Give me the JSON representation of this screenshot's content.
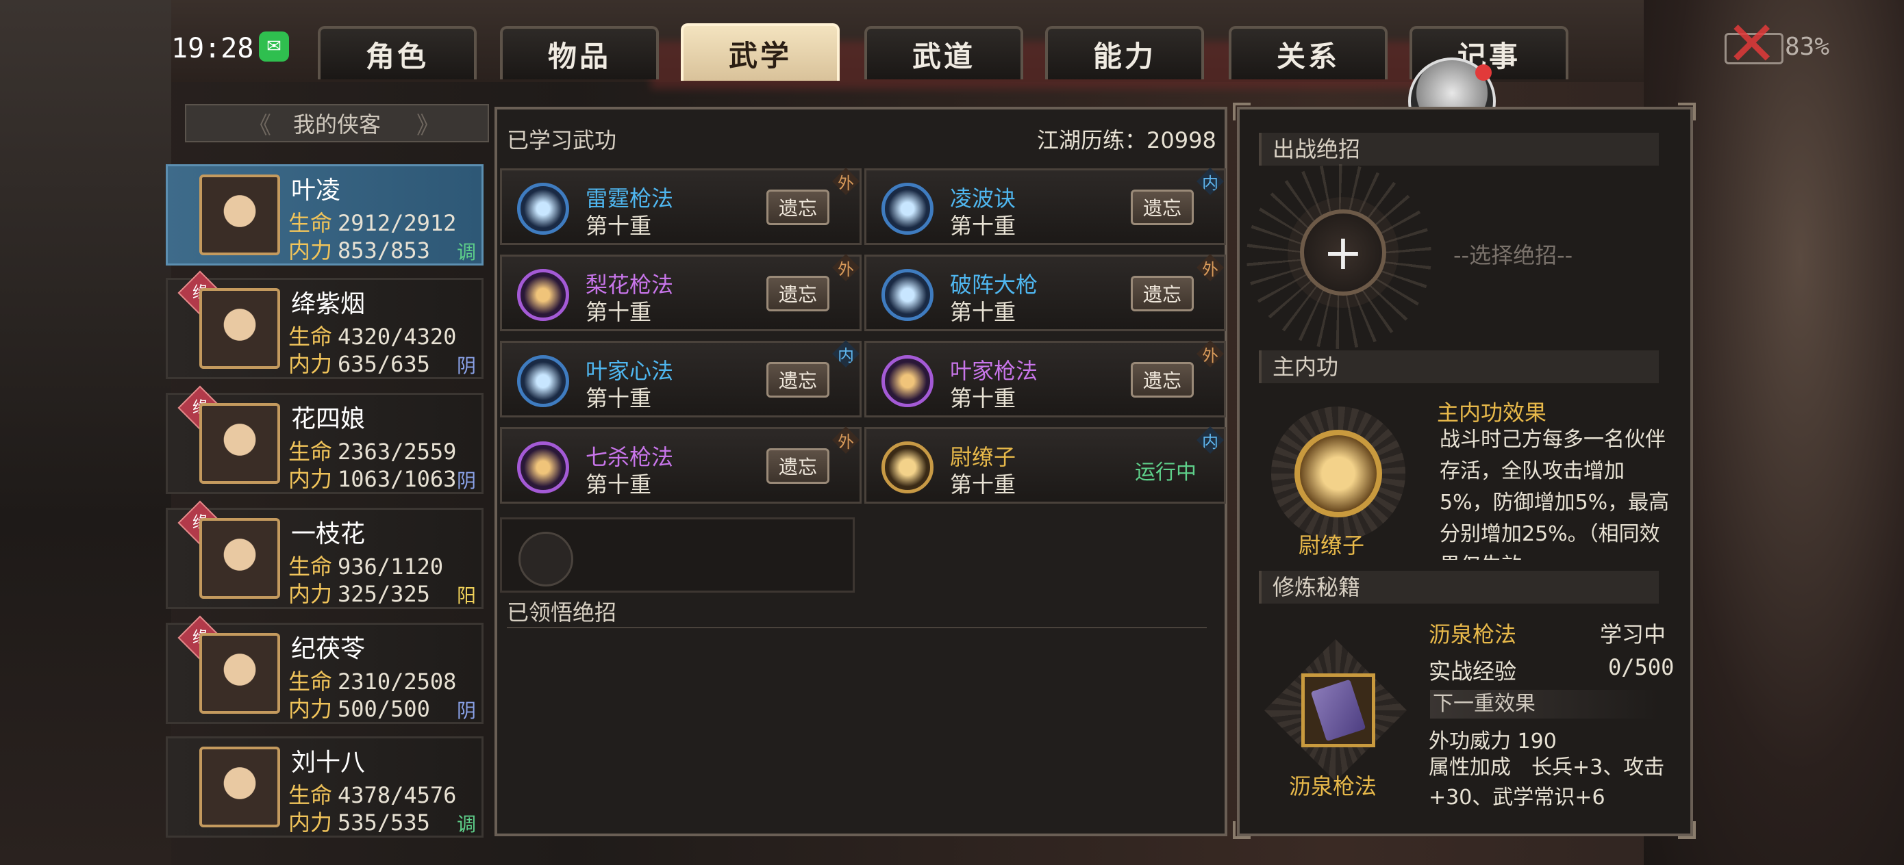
{
  "status": {
    "time": "19:28",
    "battery": "83%"
  },
  "tabs": [
    {
      "label": "角色",
      "active": false
    },
    {
      "label": "物品",
      "active": false
    },
    {
      "label": "武学",
      "active": true
    },
    {
      "label": "武道",
      "active": false
    },
    {
      "label": "能力",
      "active": false
    },
    {
      "label": "关系",
      "active": false
    },
    {
      "label": "记事",
      "active": false
    }
  ],
  "sidebar": {
    "header": "我的侠客",
    "hp_label": "生命",
    "mp_label": "内力",
    "badge": "缘",
    "characters": [
      {
        "name": "叶凌",
        "hp": "2912/2912",
        "mp": "853/853",
        "tag": "调",
        "selected": true,
        "bonded": false
      },
      {
        "name": "绛紫烟",
        "hp": "4320/4320",
        "mp": "635/635",
        "tag": "阴",
        "selected": false,
        "bonded": true
      },
      {
        "name": "花四娘",
        "hp": "2363/2559",
        "mp": "1063/1063",
        "tag": "阴",
        "selected": false,
        "bonded": true
      },
      {
        "name": "一枝花",
        "hp": "936/1120",
        "mp": "325/325",
        "tag": "阳",
        "selected": false,
        "bonded": true
      },
      {
        "name": "纪茯苓",
        "hp": "2310/2508",
        "mp": "500/500",
        "tag": "阴",
        "selected": false,
        "bonded": true
      },
      {
        "name": "刘十八",
        "hp": "4378/4576",
        "mp": "535/535",
        "tag": "调",
        "selected": false,
        "bonded": false
      }
    ]
  },
  "skills_panel": {
    "title": "已学习武功",
    "experience": "江湖历练：20998",
    "forget_label": "遗忘",
    "running_label": "运行中",
    "skills": [
      {
        "name": "雷霆枪法",
        "level": "第十重",
        "type": "外",
        "color": "blue",
        "running": false
      },
      {
        "name": "凌波诀",
        "level": "第十重",
        "type": "内",
        "color": "blue",
        "running": false
      },
      {
        "name": "梨花枪法",
        "level": "第十重",
        "type": "外",
        "color": "purple",
        "running": false
      },
      {
        "name": "破阵大枪",
        "level": "第十重",
        "type": "外",
        "color": "blue",
        "running": false
      },
      {
        "name": "叶家心法",
        "level": "第十重",
        "type": "内",
        "color": "blue",
        "running": false
      },
      {
        "name": "叶家枪法",
        "level": "第十重",
        "type": "外",
        "color": "purple",
        "running": false
      },
      {
        "name": "七杀枪法",
        "level": "第十重",
        "type": "外",
        "color": "purple",
        "running": false
      },
      {
        "name": "尉缭子",
        "level": "第十重",
        "type": "内",
        "color": "gold",
        "running": true
      }
    ],
    "ultimates_title": "已领悟绝招"
  },
  "right_panel": {
    "ultimate_title": "出战绝招",
    "ultimate_hint": "--选择绝招--",
    "main_neigong_title": "主内功",
    "main_neigong_name": "尉缭子",
    "effect_title": "主内功效果",
    "effect_text": "战斗时己方每多一名伙伴存活，全队攻击增加5%，防御增加5%，最高分别增加25%。（相同效果仅生效",
    "manual_title": "修炼秘籍",
    "manual_name": "沥泉枪法",
    "manual_status": "学习中",
    "combat_exp_label": "实战经验",
    "combat_exp_value": "0/500",
    "next_level_label": "下一重效果",
    "power_line": "外功威力 190",
    "attr_line": "属性加成　长兵+3、攻击+30、武学常识+6"
  }
}
